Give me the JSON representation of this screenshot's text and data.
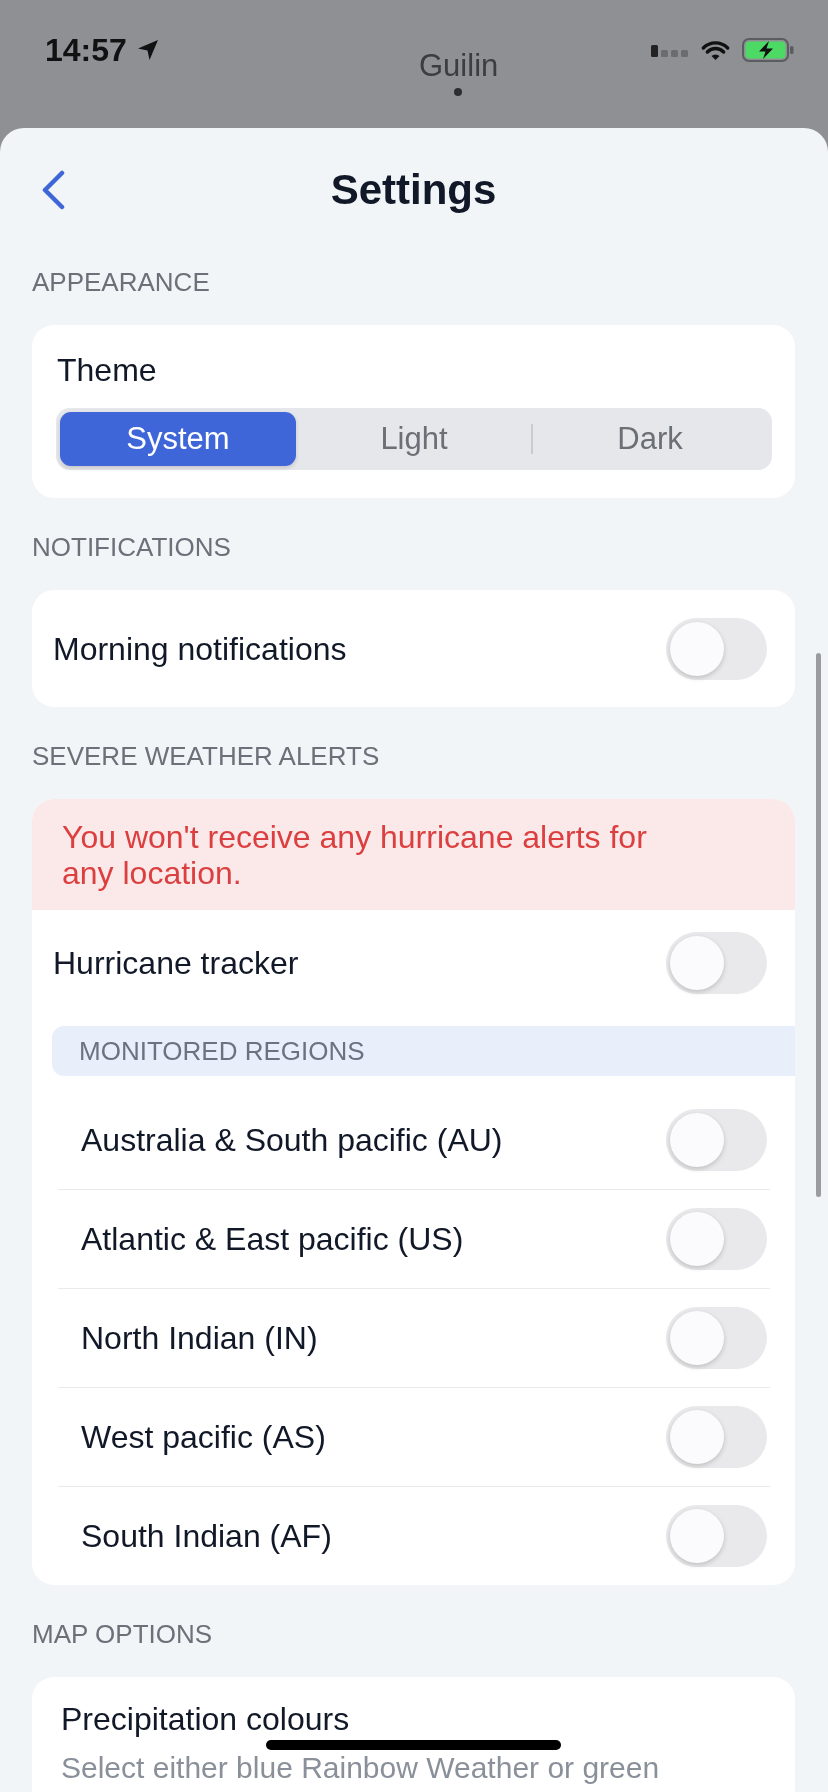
{
  "status_bar": {
    "time": "14:57"
  },
  "map": {
    "place_label": "Guilin"
  },
  "header": {
    "title": "Settings"
  },
  "sections": [
    {
      "title": "APPEARANCE",
      "items": [
        {
          "kind": "segmented",
          "label": "Theme",
          "options": [
            {
              "label": "System",
              "selected": true
            },
            {
              "label": "Light",
              "selected": false
            },
            {
              "label": "Dark",
              "selected": false
            }
          ]
        }
      ]
    },
    {
      "title": "NOTIFICATIONS",
      "items": [
        {
          "kind": "toggle",
          "label": "Morning notifications",
          "on": false
        }
      ]
    },
    {
      "title": "SEVERE WEATHER ALERTS",
      "items": [
        {
          "kind": "alert",
          "text": "You won't receive any hurricane alerts for any location."
        },
        {
          "kind": "toggle",
          "label": "Hurricane tracker",
          "on": false
        },
        {
          "kind": "group",
          "title": "MONITORED REGIONS",
          "items": [
            {
              "label": "Australia & South pacific (AU)",
              "on": false
            },
            {
              "label": "Atlantic & East pacific (US)",
              "on": false
            },
            {
              "label": "North Indian (IN)",
              "on": false
            },
            {
              "label": "West pacific (AS)",
              "on": false
            },
            {
              "label": "South Indian (AF)",
              "on": false
            }
          ]
        }
      ]
    },
    {
      "title": "MAP OPTIONS",
      "items": [
        {
          "kind": "info",
          "label": "Precipitation colours",
          "description": "Select either blue Rainbow Weather or green"
        }
      ]
    }
  ]
}
